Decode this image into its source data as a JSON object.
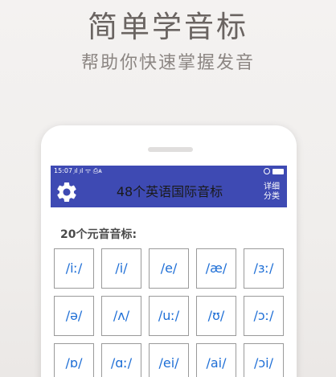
{
  "promo": {
    "headline": "简单学音标",
    "subline": "帮助你快速掌握发音"
  },
  "status_bar": {
    "left": "15:07 ᷊ıl ᷊ıl ᯤ ⎙ᴀ",
    "icons": [
      "alarm-icon",
      "battery-icon"
    ]
  },
  "toolbar": {
    "settings_icon": "gear-icon",
    "title": "48个英语国际音标",
    "detail_line1": "详细",
    "detail_line2": "分类"
  },
  "section": {
    "title": "20个元音音标:"
  },
  "vowels": [
    "/iː/",
    "/i/",
    "/e/",
    "/æ/",
    "/ɜː/",
    "/ə/",
    "/ʌ/",
    "/uː/",
    "/ʊ/",
    "/ɔː/",
    "/ɒ/",
    "/ɑː/",
    "/ei/",
    "/ai/",
    "/ɔi/"
  ],
  "colors": {
    "toolbar": "#3e4ab3",
    "symbol_text": "#1f6fd6"
  }
}
